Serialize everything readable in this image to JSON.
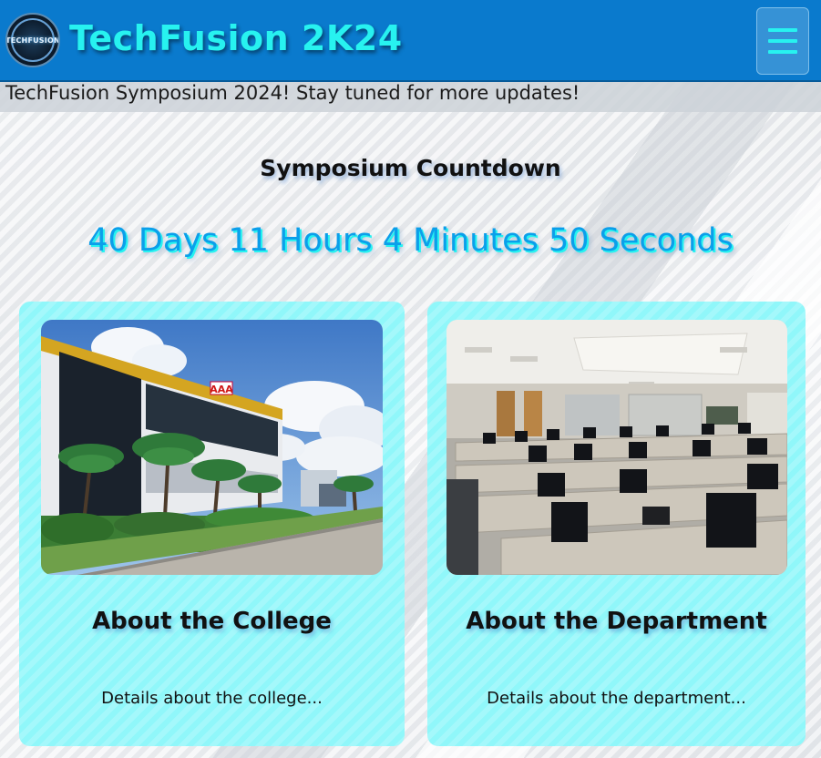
{
  "header": {
    "logo_text": "TECHFUSION",
    "title": "TechFusion 2K24",
    "menu_icon": "hamburger-menu-icon"
  },
  "ticker": {
    "text": "TechFusion Symposium 2024! Stay tuned for more updates!"
  },
  "countdown": {
    "title": "Symposium Countdown",
    "value": "40 Days 11 Hours 4 Minutes 50 Seconds"
  },
  "cards": [
    {
      "title": "About the College",
      "description": "Details about the college...",
      "image_sign": "AAA"
    },
    {
      "title": "About the Department",
      "description": "Details about the department..."
    }
  ],
  "colors": {
    "header_bg": "#0a7acd",
    "title_color": "#27f2f0",
    "countdown_color": "#0b9fea",
    "card_bg": "#90f7fa"
  }
}
